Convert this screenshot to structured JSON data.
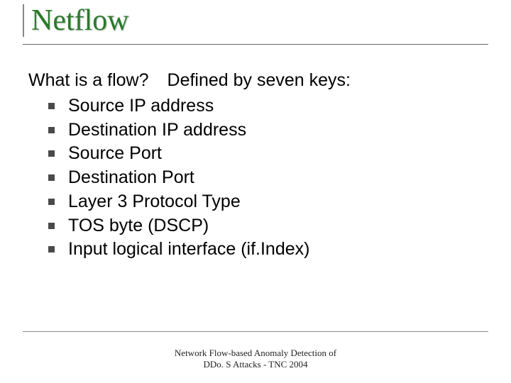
{
  "slide": {
    "title": "Netflow",
    "intro_q": "What is a flow?",
    "intro_def": "Defined by seven keys:",
    "bullets": {
      "0": "Source IP address",
      "1": "Destination IP address",
      "2": "Source Port",
      "3": "Destination Port",
      "4": "Layer 3 Protocol Type",
      "5": "TOS byte (DSCP)",
      "6": "Input logical interface (if.Index)"
    },
    "footer_line1": "Network Flow-based Anomaly Detection of",
    "footer_line2": "DDo. S Attacks - TNC 2004"
  }
}
